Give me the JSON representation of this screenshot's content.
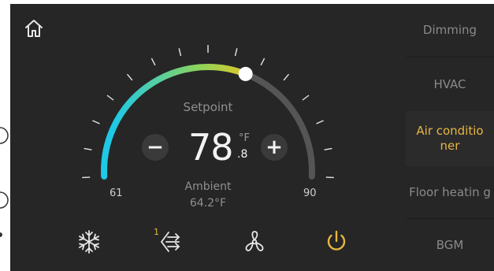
{
  "thermostat": {
    "setpoint_label": "Setpoint",
    "temp_integer": "78",
    "temp_unit": "°F",
    "temp_decimal": ".8",
    "ambient_label": "Ambient",
    "ambient_value": "64.2°F",
    "min_label": "61",
    "max_label": "90",
    "min_value": 61,
    "max_value": 90,
    "setpoint_value": 78.8,
    "minus_label": "−",
    "plus_label": "+"
  },
  "controls": {
    "fan_speed_level": "1",
    "mode_icon": "snowflake-icon",
    "fan_speed_icon": "fan-speed-icon",
    "swing_icon": "fan-icon",
    "power_icon": "power-icon"
  },
  "sidebar": {
    "items": [
      {
        "label": "Dimming",
        "active": false
      },
      {
        "label": "HVAC",
        "active": false
      },
      {
        "label": "Air conditio ner",
        "active": true
      },
      {
        "label": "Floor heatin g",
        "active": false
      },
      {
        "label": "BGM",
        "active": false
      }
    ]
  },
  "colors": {
    "panel_bg": "#262626",
    "accent": "#e8b640",
    "arc_cool": "#1ec9e6",
    "arc_warm": "#f0c419",
    "arc_track": "#555555"
  }
}
